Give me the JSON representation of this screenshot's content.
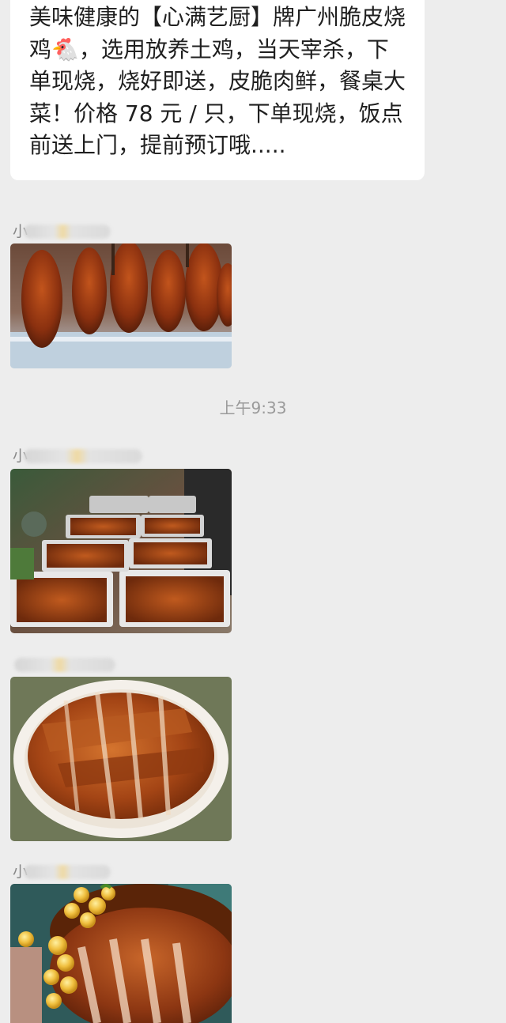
{
  "message": {
    "text": "美味健康的【心满艺厨】牌广州脆皮烧鸡🐔，选用放养土鸡，当天宰杀，下单现烧，烧好即送，皮脆肉鲜，餐桌大菜！价格 78 元 / 只，下单现烧，饭点前送上门，提前预订哦....."
  },
  "timestamp": "上午9:33",
  "senders": [
    {
      "initial": "小"
    },
    {
      "initial": "小"
    },
    {
      "initial": ""
    },
    {
      "initial": "小"
    }
  ],
  "photos": [
    {
      "icon": "roast-ducks-hanging-image"
    },
    {
      "icon": "roast-chicken-trays-image"
    },
    {
      "icon": "sliced-roast-chicken-plate-image"
    },
    {
      "icon": "roast-goose-with-plums-image"
    }
  ]
}
